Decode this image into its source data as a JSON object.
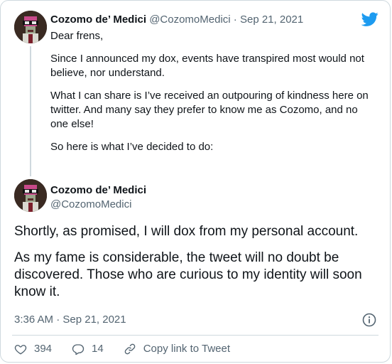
{
  "brand": {
    "accent": "#1d9bf0",
    "text": "#0f1419",
    "muted": "#536471",
    "border": "#cfd9de"
  },
  "quoted_tweet": {
    "display_name": "Cozomo de’ Medici",
    "handle": "@CozomoMedici",
    "separator": " · ",
    "date": "Sep 21, 2021",
    "paragraphs": [
      "Dear frens,",
      "Since I announced my dox, events have transpired most would not believe, nor understand.",
      "What I can share is I’ve received an outpouring of kindness here on twitter. And many say they prefer to know me as Cozomo, and no one else!",
      "So here is what I’ve decided to do:"
    ]
  },
  "main_tweet": {
    "display_name": "Cozomo de’ Medici",
    "handle": "@CozomoMedici",
    "paragraphs": [
      "Shortly, as promised, I will dox from my personal account.",
      "As my fame is considerable, the tweet will no doubt be discovered. Those who are curious to my identity will soon know it."
    ],
    "timestamp": "3:36 AM · Sep 21, 2021"
  },
  "actions": {
    "like_count": "394",
    "reply_count": "14",
    "copy_link_label": "Copy link to Tweet"
  },
  "icons": {
    "logo": "twitter-bird-icon",
    "info": "info-icon",
    "like": "heart-icon",
    "reply": "reply-bubble-icon",
    "copy": "link-icon"
  }
}
